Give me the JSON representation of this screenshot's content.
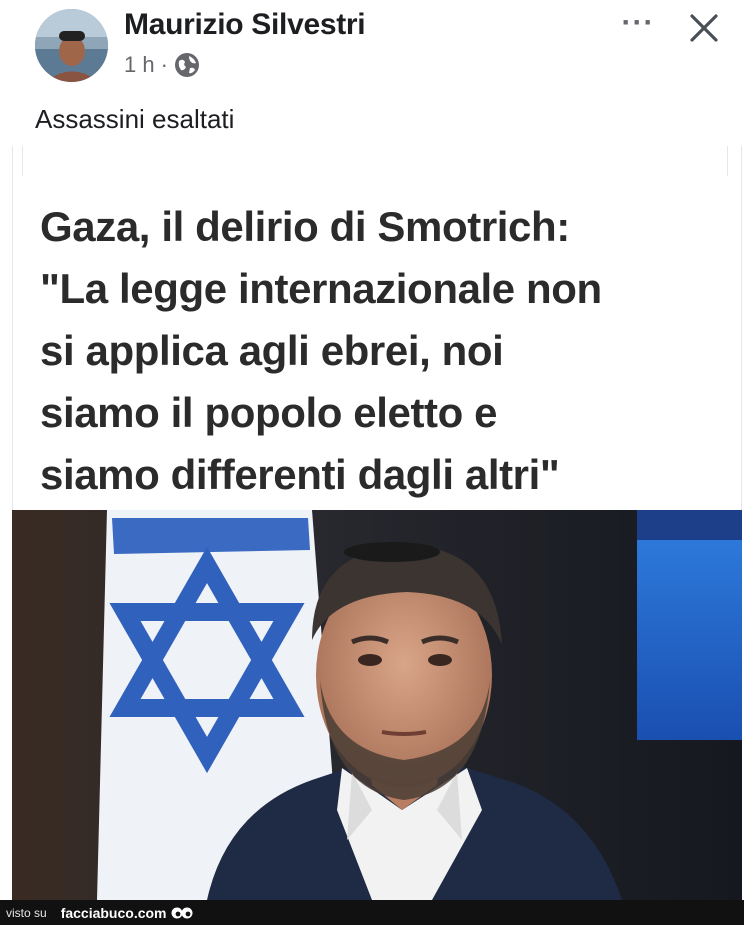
{
  "post": {
    "author": "Maurizio Silvestri",
    "time": "1 h",
    "separator": "·",
    "privacy_icon": "globe-icon",
    "caption": "Assassini esaltati"
  },
  "shared": {
    "headline_lines": [
      "Gaza, il delirio di Smotrich:",
      "\"La legge internazionale non",
      "si applica agli ebrei, noi",
      "siamo il popolo eletto e",
      "siamo differenti dagli altri\""
    ],
    "image_icon": "portrait-photo"
  },
  "header_actions": {
    "more_label": "···",
    "more_icon": "more-dots-icon",
    "close_icon": "close-icon"
  },
  "watermark": {
    "prefix": "visto su",
    "site": "facciabuco.com",
    "site_icon": "eyes-icon"
  },
  "colors": {
    "flag_blue": "#1f55b8",
    "flag_white": "#f4f6fa",
    "background": "#ffffff"
  }
}
